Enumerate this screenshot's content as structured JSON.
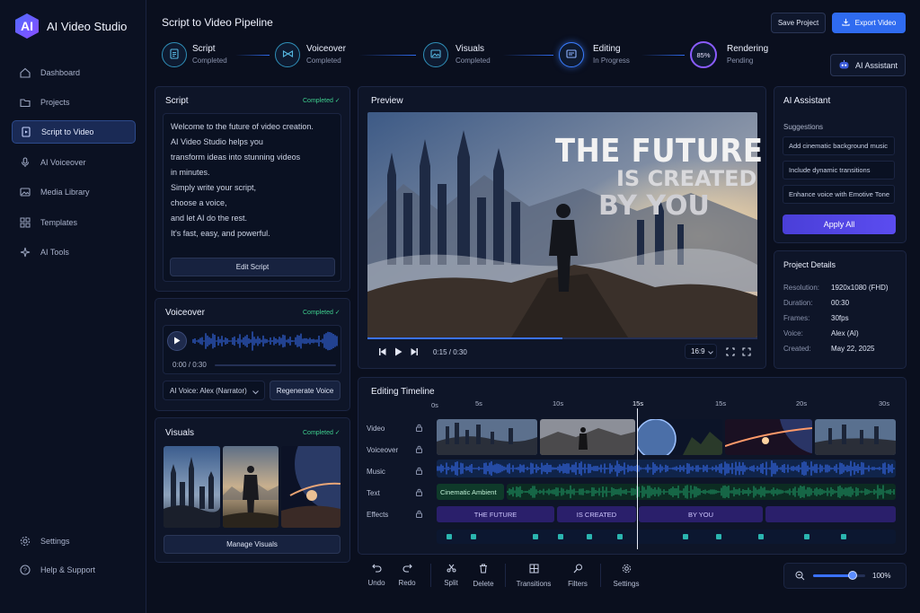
{
  "app": {
    "logo": "AI",
    "title": "AI Video Studio"
  },
  "sidebar": {
    "items": [
      {
        "label": "Dashboard",
        "icon": "home-icon"
      },
      {
        "label": "Projects",
        "icon": "folder-icon"
      },
      {
        "label": "Script to Video",
        "icon": "document-play-icon",
        "active": true
      },
      {
        "label": "AI Voiceover",
        "icon": "microphone-icon"
      },
      {
        "label": "Media Library",
        "icon": "image-icon"
      },
      {
        "label": "Templates",
        "icon": "grid-icon"
      },
      {
        "label": "AI Tools",
        "icon": "sparkle-icon"
      }
    ],
    "bottom": [
      {
        "label": "Settings",
        "icon": "gear-icon"
      },
      {
        "label": "Help & Support",
        "icon": "help-icon"
      }
    ]
  },
  "header": {
    "title": "Script to Video Pipeline",
    "save_label": "Save Project",
    "export_label": "Export Video",
    "assistant_label": "AI Assistant"
  },
  "pipeline": [
    {
      "name": "Script",
      "status": "Completed"
    },
    {
      "name": "Voiceover",
      "status": "Completed"
    },
    {
      "name": "Visuals",
      "status": "Completed"
    },
    {
      "name": "Editing",
      "status": "In Progress"
    },
    {
      "name": "Rendering",
      "status": "Pending",
      "progress": "85%"
    }
  ],
  "script_panel": {
    "title": "Script",
    "status": "Completed ✓",
    "lines": [
      "Welcome to the future of video creation.",
      "AI Video Studio helps you",
      "transform ideas into stunning videos",
      "in minutes.",
      "Simply write your script,",
      "choose a voice,",
      "and let AI do the rest.",
      "It's fast, easy, and powerful."
    ],
    "edit_label": "Edit Script"
  },
  "voiceover_panel": {
    "title": "Voiceover",
    "status": "Completed ✓",
    "time": "0:00 / 0:30",
    "voice_select": "AI Voice: Alex (Narrator)",
    "regenerate_label": "Regenerate Voice"
  },
  "visuals_panel": {
    "title": "Visuals",
    "status": "Completed ✓",
    "manage_label": "Manage Visuals"
  },
  "preview": {
    "title": "Preview",
    "overlay_line1": "THE FUTURE",
    "overlay_line2": "IS CREATED",
    "overlay_line3": "BY YOU",
    "time": "0:15 / 0:30",
    "aspect": "16:9",
    "progress": 0.5
  },
  "assistant": {
    "title": "AI Assistant",
    "suggestions_label": "Suggestions",
    "suggestions": [
      "Add cinematic background music",
      "Include dynamic transitions",
      "Enhance voice with Emotive Tone"
    ],
    "apply_label": "Apply All"
  },
  "project_details": {
    "title": "Project Details",
    "rows": [
      {
        "label": "Resolution:",
        "value": "1920x1080 (FHD)"
      },
      {
        "label": "Duration:",
        "value": "00:30"
      },
      {
        "label": "Frames:",
        "value": "30fps"
      },
      {
        "label": "Voice:",
        "value": "Alex (AI)"
      },
      {
        "label": "Created:",
        "value": "May 22, 2025"
      }
    ]
  },
  "timeline": {
    "title": "Editing Timeline",
    "ruler": [
      "0s",
      "5s",
      "10s",
      "15s",
      "15s",
      "20s",
      "30s"
    ],
    "tracks": [
      "Video",
      "Voiceover",
      "Music",
      "Text",
      "Effects"
    ],
    "music_clip": "Cinematic Ambient",
    "text_clips": [
      "THE FUTURE",
      "IS CREATED",
      "BY YOU"
    ]
  },
  "toolbar": {
    "tools": [
      {
        "label": "Undo",
        "icon": "undo-icon"
      },
      {
        "label": "Redo",
        "icon": "redo-icon"
      },
      {
        "label": "Split",
        "icon": "scissors-icon"
      },
      {
        "label": "Delete",
        "icon": "trash-icon"
      },
      {
        "label": "Transitions",
        "icon": "transitions-icon"
      },
      {
        "label": "Filters",
        "icon": "filters-icon"
      },
      {
        "label": "Settings",
        "icon": "gear-icon"
      }
    ],
    "zoom": "100%",
    "zoom_level": 0.75
  },
  "colors": {
    "accent": "#2f6bf0",
    "success": "#3ecf8e",
    "purple": "#5b4cf0",
    "wave_blue": "#3a72ff",
    "wave_green": "#21a06a"
  }
}
